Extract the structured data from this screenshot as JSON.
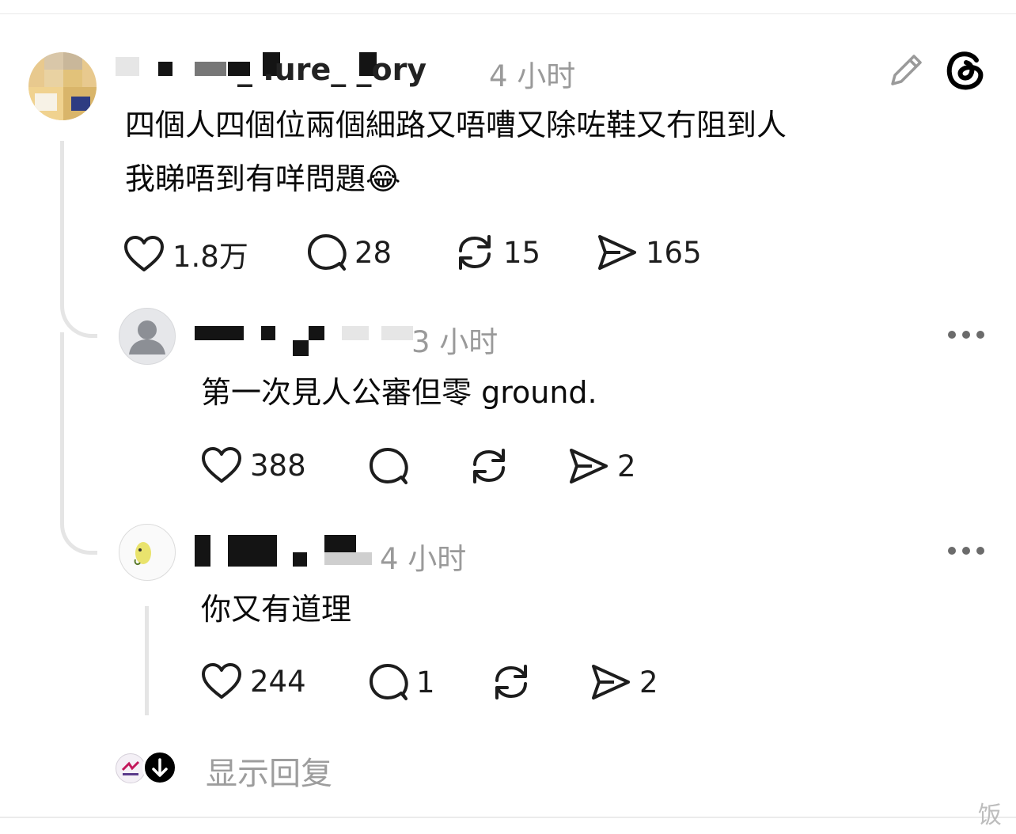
{
  "main_post": {
    "username": "_ .ure_ _ory",
    "time": "4 小时",
    "text_line1": "四個人四個位兩個細路又唔嘈又除咗鞋又冇阻到人",
    "text_line2": "我睇唔到有咩問題😂",
    "likes": "1.8万",
    "comments": "28",
    "reposts": "15",
    "shares": "165"
  },
  "reply1": {
    "username": "",
    "time": "3 小时",
    "text": "第一次見人公審但零 ground.",
    "likes": "388",
    "comments": "",
    "reposts": "",
    "shares": "2"
  },
  "reply2": {
    "username": "",
    "time": "4 小时",
    "text": "你又有道理",
    "likes": "244",
    "comments": "1",
    "reposts": "",
    "shares": "2"
  },
  "footer": {
    "show_replies": "显示回复",
    "watermark": "饭"
  },
  "icons": {
    "edit": "pencil-icon",
    "app": "threads-logo-icon",
    "like": "heart-icon",
    "comment": "comment-bubble-icon",
    "repost": "repost-icon",
    "share": "send-icon",
    "more": "more-dots-icon",
    "expand": "arrow-down-icon"
  }
}
